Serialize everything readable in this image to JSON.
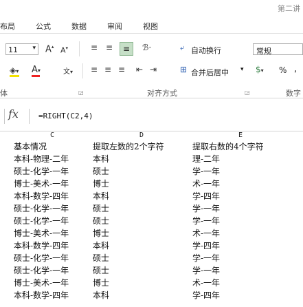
{
  "title_right": "第二讲",
  "tabs": [
    "布局",
    "公式",
    "数据",
    "审阅",
    "视图"
  ],
  "font_size": "11",
  "font_grow": "A",
  "font_shrink": "A",
  "wrap_text": "自动换行",
  "merge_center": "合并后居中",
  "number_format": "常规",
  "percent": "%",
  "comma": ",",
  "group_labels": {
    "font_tail": "体",
    "alignment": "对齐方式",
    "number": "数字"
  },
  "formula_bar": {
    "fx": "fx",
    "formula": "=RIGHT(C2,4)"
  },
  "columns": [
    "C",
    "D",
    "E"
  ],
  "headers": [
    "基本情况",
    "提取左数的2个字符",
    "提取右数的4个字符"
  ],
  "rows": [
    [
      "本科-物理-二年",
      "本科",
      "理-二年"
    ],
    [
      "硕士-化学-一年",
      "硕士",
      "学-一年"
    ],
    [
      "博士-美术-一年",
      "博士",
      "术-一年"
    ],
    [
      "本科-数学-四年",
      "本科",
      "学-四年"
    ],
    [
      "硕士-化学-一年",
      "硕士",
      "学-一年"
    ],
    [
      "硕士-化学-一年",
      "硕士",
      "学-一年"
    ],
    [
      "博士-美术-一年",
      "博士",
      "术-一年"
    ],
    [
      "本科-数学-四年",
      "本科",
      "学-四年"
    ],
    [
      "硕士-化学-一年",
      "硕士",
      "学-一年"
    ],
    [
      "硕士-化学-一年",
      "硕士",
      "学-一年"
    ],
    [
      "博士-美术-一年",
      "博士",
      "术-一年"
    ],
    [
      "本科-数学-四年",
      "本科",
      "学-四年"
    ]
  ],
  "accent": "#217346"
}
